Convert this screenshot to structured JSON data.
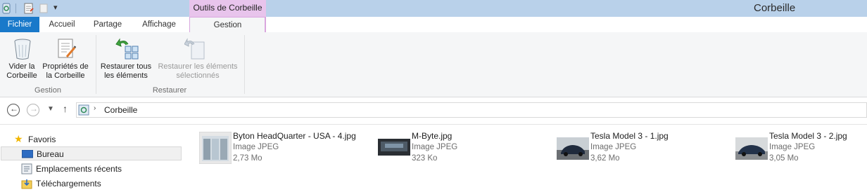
{
  "window": {
    "title": "Corbeille",
    "contextual_header": "Outils de Corbeille"
  },
  "tabs": {
    "file": "Fichier",
    "home": "Accueil",
    "share": "Partage",
    "view": "Affichage",
    "manage": "Gestion"
  },
  "ribbon": {
    "empty_bin": {
      "line1": "Vider la",
      "line2": "Corbeille"
    },
    "bin_props": {
      "line1": "Propriétés de",
      "line2": "la Corbeille"
    },
    "restore_all": {
      "line1": "Restaurer tous",
      "line2": "les éléments"
    },
    "restore_selected": {
      "line1": "Restaurer les éléments",
      "line2": "sélectionnés"
    },
    "group_manage": "Gestion",
    "group_restore": "Restaurer"
  },
  "address": {
    "location": "Corbeille"
  },
  "nav_pane": {
    "favorites": "Favoris",
    "desktop": "Bureau",
    "recent": "Emplacements récents",
    "downloads": "Téléchargements"
  },
  "files": [
    {
      "name": "Byton HeadQuarter - USA - 4.jpg",
      "type": "Image JPEG",
      "size": "2,73 Mo"
    },
    {
      "name": "M-Byte.jpg",
      "type": "Image JPEG",
      "size": "323 Ko"
    },
    {
      "name": "Tesla Model 3 - 1.jpg",
      "type": "Image JPEG",
      "size": "3,62 Mo"
    },
    {
      "name": "Tesla Model 3 - 2.jpg",
      "type": "Image JPEG",
      "size": "3,05 Mo"
    }
  ],
  "colors": {
    "file_tab": "#1979ca",
    "title_bar": "#b9d1ea",
    "contextual": "#e8c4ec"
  }
}
